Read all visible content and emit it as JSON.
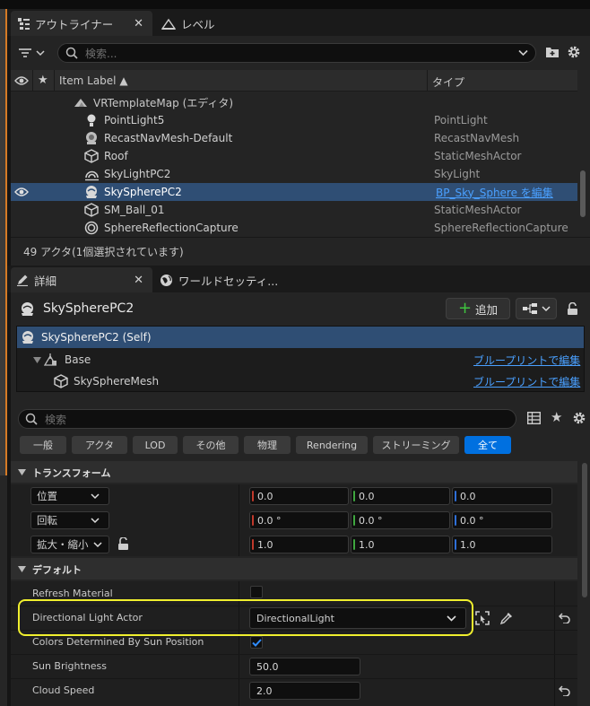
{
  "tabs": {
    "outliner": "アウトライナー",
    "levels": "レベル"
  },
  "outliner": {
    "search_placeholder": "検索...",
    "col_item_label": "Item Label ▲",
    "col_type": "タイプ",
    "rows": [
      {
        "label": "VRTemplateMap (エディタ)",
        "type": "",
        "icon": "map-icon"
      },
      {
        "label": "PointLight5",
        "type": "PointLight",
        "icon": "point-light-icon"
      },
      {
        "label": "RecastNavMesh-Default",
        "type": "RecastNavMesh",
        "icon": "navmesh-icon"
      },
      {
        "label": "Roof",
        "type": "StaticMeshActor",
        "icon": "static-mesh-icon"
      },
      {
        "label": "SkyLightPC2",
        "type": "SkyLight",
        "icon": "sky-light-icon"
      },
      {
        "label": "SkySpherePC2",
        "type": "BP_Sky_Sphere を編集",
        "icon": "sky-sphere-icon"
      },
      {
        "label": "SM_Ball_01",
        "type": "StaticMeshActor",
        "icon": "static-mesh-icon"
      },
      {
        "label": "SphereReflectionCapture",
        "type": "SphereReflectionCapture",
        "icon": "reflection-capture-icon"
      }
    ],
    "status": "49 アクタ(1個選択されています)"
  },
  "details_tabs": {
    "details": "詳細",
    "world_settings": "ワールドセッティ..."
  },
  "details": {
    "actor_name": "SkySpherePC2",
    "add_button": "追加",
    "components": [
      {
        "label": "SkySpherePC2 (Self)",
        "link": ""
      },
      {
        "label": "Base",
        "link": "ブループリントで編集"
      },
      {
        "label": "SkySphereMesh",
        "link": "ブループリントで編集"
      }
    ],
    "search_placeholder": "検索",
    "filters": [
      "一般",
      "アクタ",
      "LOD",
      "その他",
      "物理",
      "Rendering",
      "ストリーミング",
      "全て"
    ],
    "transform": {
      "title": "トランスフォーム",
      "location_label": "位置",
      "location": [
        "0.0",
        "0.0",
        "0.0"
      ],
      "rotation_label": "回転",
      "rotation": [
        "0.0 °",
        "0.0 °",
        "0.0 °"
      ],
      "scale_label": "拡大・縮小",
      "scale": [
        "1.0",
        "1.0",
        "1.0"
      ]
    },
    "default": {
      "title": "デフォルト",
      "refresh_material": "Refresh Material",
      "directional_light_actor": "Directional Light Actor",
      "directional_light_value": "DirectionalLight",
      "colors_by_sun": "Colors Determined By Sun Position",
      "sun_brightness": "Sun Brightness",
      "sun_brightness_value": "50.0",
      "cloud_speed": "Cloud Speed",
      "cloud_speed_value": "2.0"
    }
  },
  "colors": {
    "accent": "#0070e0",
    "selected_row": "#2f4e74",
    "highlight_outline": "#f0ef2e",
    "x_axis": "#c0392b",
    "y_axis": "#3fa73f",
    "z_axis": "#2e6fd8"
  }
}
